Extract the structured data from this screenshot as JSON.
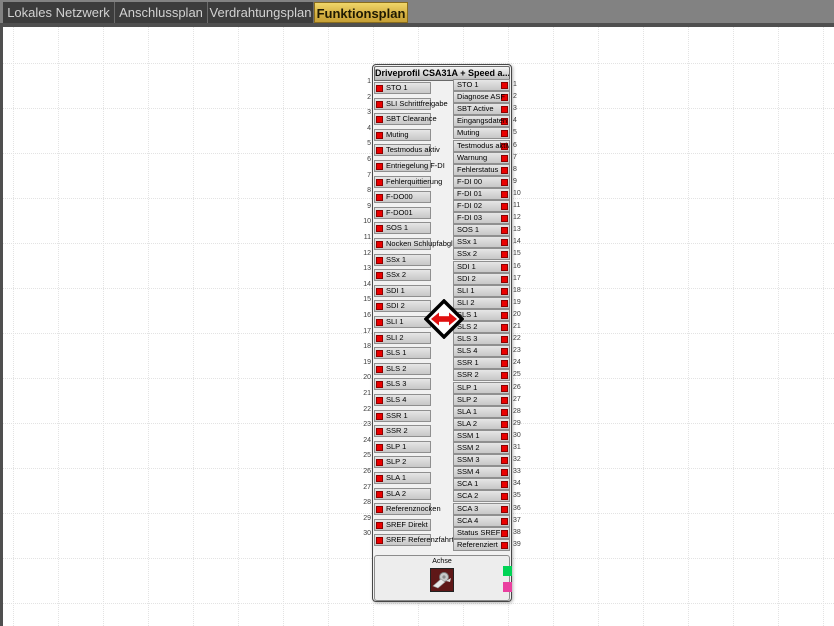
{
  "tabs": [
    {
      "label": "Lokales Netzwerk",
      "active": false
    },
    {
      "label": "Anschlussplan",
      "active": false
    },
    {
      "label": "Verdrahtungsplan",
      "active": false
    },
    {
      "label": "Funktionsplan",
      "active": true
    }
  ],
  "block": {
    "title": "Driveprofil CSA31A + Speed a...",
    "inputs": [
      "STO 1",
      "SLI Schrittfreigabe",
      "SBT Clearance",
      "Muting",
      "Testmodus aktiv",
      "Entriegelung F-DI",
      "Fehlerquittierung",
      "F-DO00",
      "F-DO01",
      "SOS 1",
      "Nocken Schlupfabgleich",
      "SSx 1",
      "SSx 2",
      "SDI 1",
      "SDI 2",
      "SLI 1",
      "SLI 2",
      "SLS 1",
      "SLS 2",
      "SLS 3",
      "SLS 4",
      "SSR 1",
      "SSR 2",
      "SLP 1",
      "SLP 2",
      "SLA 1",
      "SLA 2",
      "Referenznocken",
      "SREF Direkt",
      "SREF Referenzfahrt"
    ],
    "outputs": [
      "STO 1",
      "Diagnose ASF",
      "SBT Active",
      "Eingangsdaten gültig",
      "Muting",
      "Testmodus aktiv",
      "Warnung",
      "Fehlerstatus",
      "F-DI 00",
      "F-DI 01",
      "F-DI 02",
      "F-DI 03",
      "SOS 1",
      "SSx 1",
      "SSx 2",
      "SDI 1",
      "SDI 2",
      "SLI 1",
      "SLI 2",
      "SLS 1",
      "SLS 2",
      "SLS 3",
      "SLS 4",
      "SSR 1",
      "SSR 2",
      "SLP 1",
      "SLP 2",
      "SLA 1",
      "SLA 2",
      "SSM 1",
      "SSM 2",
      "SSM 3",
      "SSM 4",
      "SCA 1",
      "SCA 2",
      "SCA 3",
      "SCA 4",
      "Status SREF",
      "Referenziert"
    ],
    "footer": {
      "axis_label": "Achse"
    }
  },
  "colors": {
    "pin_marker": "#ea0000",
    "axis_port_green": "#00d455",
    "axis_port_magenta": "#ea3f9f",
    "active_tab": "#d7b244",
    "tabbar_bg": "#828282",
    "inactive_tab": "#3c3c3c"
  }
}
